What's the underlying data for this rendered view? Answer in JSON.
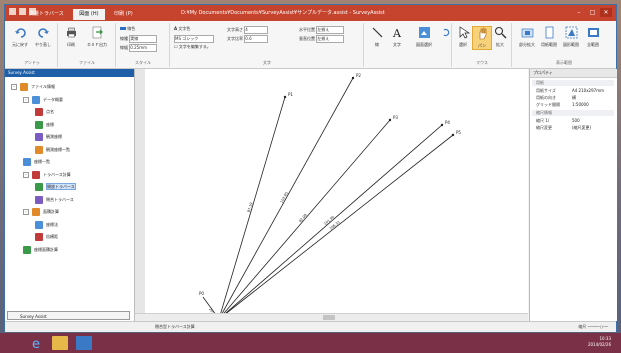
{
  "window_title": "D:¥My Documents¥Documents¥SurveyAssist¥サンプルデータ.assist - SurveyAssist",
  "ribbon_tabs": [
    "測量トラバース",
    "図面 (H)",
    "印刷 (P)"
  ],
  "active_tab_index": 1,
  "ribbon": {
    "groups": [
      "アンドゥ",
      "ファイル",
      "スタイル",
      "文字",
      "マウス",
      "表示範囲"
    ],
    "undo_label": "元に戻す",
    "redo_label": "やり直し",
    "print_label": "印刷",
    "dxf_label": "ＤＸＦ出力",
    "line_style": "実線",
    "line_width": "0.25mm",
    "font": "MS ゴシック",
    "font_color": "文字色",
    "text_height": "文字高さ",
    "text_height_val": "4",
    "text_ratio": "文字比率",
    "text_ratio_val": "0.6",
    "h_pos": "水平位置",
    "h_pos_val": "左揃え",
    "v_pos": "垂直位置",
    "v_pos_val": "左揃え",
    "edit_text_check": "文字を編集する。",
    "line_tool": "線",
    "text_tool": "文字",
    "edit_select": "図面選択",
    "select_tool": "選択",
    "pan_tool": "パン",
    "zoom_in": "拡大",
    "zoom_part": "部分拡大",
    "zoom_extent": "用紙範囲",
    "zoom_shape": "図形範囲",
    "zoom_all": "全範囲"
  },
  "left_pane": {
    "title": "Survey Assist",
    "tree": [
      {
        "label": "ファイル情報",
        "level": 0,
        "expander": "-"
      },
      {
        "label": "データ概要",
        "level": 1,
        "expander": "-"
      },
      {
        "label": "点名",
        "level": 2
      },
      {
        "label": "座標",
        "level": 2
      },
      {
        "label": "観測座標",
        "level": 2
      },
      {
        "label": "観測座標一覧",
        "level": 2
      },
      {
        "label": "座標一覧",
        "level": 1
      },
      {
        "label": "トラバース計算",
        "level": 1,
        "expander": "-"
      },
      {
        "label": "開放トラバース",
        "level": 2,
        "selected": true
      },
      {
        "label": "閉合トラバース",
        "level": 2
      },
      {
        "label": "面積計算",
        "level": 1,
        "expander": "-"
      },
      {
        "label": "座標法",
        "level": 2
      },
      {
        "label": "倍横距",
        "level": 2
      },
      {
        "label": "座標面積計算",
        "level": 1
      }
    ],
    "footer": "Survey Assist"
  },
  "drawing": {
    "lines": [
      {
        "label": "P1",
        "dist": "87.19"
      },
      {
        "label": "P2",
        "dist": "103.65"
      },
      {
        "label": "P3",
        "dist": "82.08"
      },
      {
        "label": "P4",
        "dist": "101.90"
      },
      {
        "label": "P5",
        "dist": "106.31"
      }
    ],
    "origin_label": "P0",
    "origin_dist": "20.00"
  },
  "properties": {
    "title": "プロパティ",
    "section1": "用紙",
    "rows1": [
      {
        "k": "用紙サイズ",
        "v": "A4 210x297mm"
      },
      {
        "k": "用紙の向き",
        "v": "横"
      },
      {
        "k": "グリッド間隔",
        "v": "1:50000"
      }
    ],
    "section2": "縮尺情報",
    "rows2": [
      {
        "k": "縮尺 1/",
        "v": "500"
      },
      {
        "k": "縮尺変更",
        "v": "(縮尺変更)"
      }
    ]
  },
  "status": {
    "text": "閉合型トラバース計算",
    "zoom": "縮尺"
  },
  "clock": {
    "time": "10:33",
    "date": "2014/02/26"
  }
}
